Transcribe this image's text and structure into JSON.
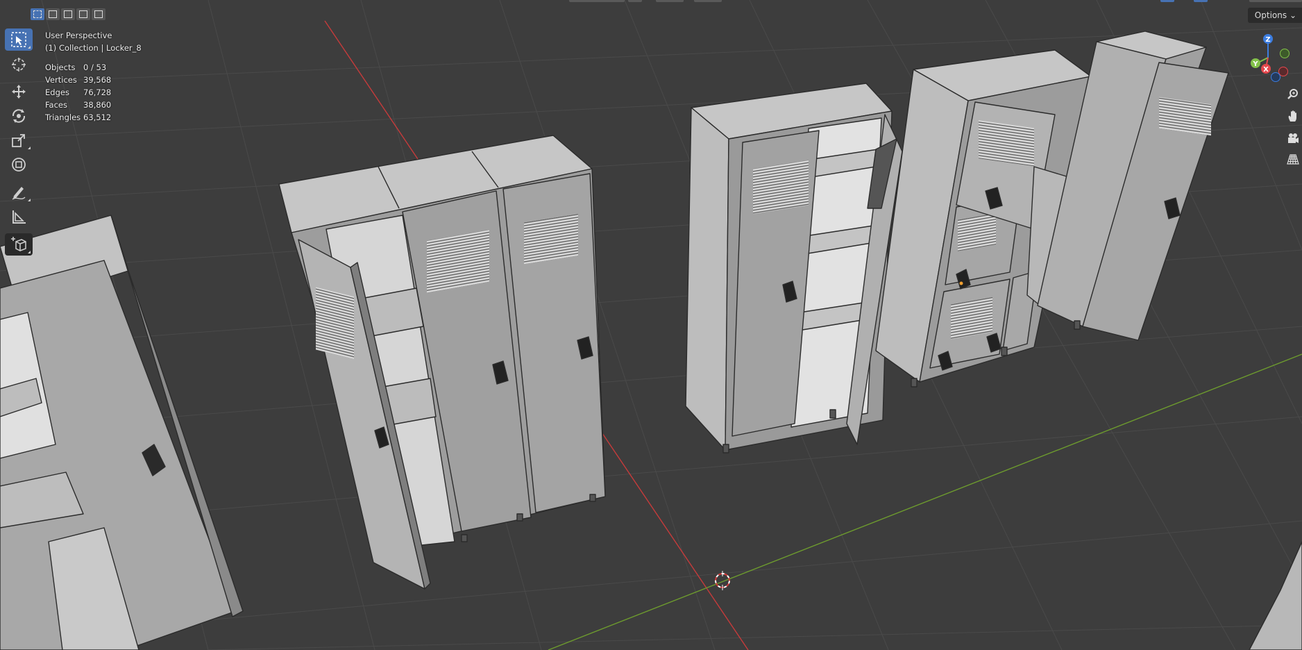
{
  "viewport": {
    "view_name": "User Perspective",
    "collection_line": "(1) Collection | Locker_8"
  },
  "stats": [
    {
      "label": "Objects",
      "value": "0 / 53"
    },
    {
      "label": "Vertices",
      "value": "39,568"
    },
    {
      "label": "Edges",
      "value": "76,728"
    },
    {
      "label": "Faces",
      "value": "38,860"
    },
    {
      "label": "Triangles",
      "value": "63,512"
    }
  ],
  "header": {
    "options_label": "Options",
    "select_modes": [
      "select-new-icon",
      "select-extend-icon",
      "select-subtract-icon",
      "select-invert-icon",
      "select-intersect-icon"
    ]
  },
  "toolbar": {
    "tools": [
      "select-box-icon",
      "cursor-icon",
      "move-icon",
      "rotate-icon",
      "scale-icon",
      "transform-icon",
      "annotate-icon",
      "measure-icon",
      "add-cube-icon"
    ],
    "active_tool": "select-box-icon"
  },
  "gizmo": {
    "x_label": "X",
    "y_label": "Y",
    "z_label": "Z",
    "colors": {
      "x": "#e5484d",
      "y": "#83c14a",
      "z": "#3c7de0"
    }
  },
  "nav_tools": [
    "zoom-icon",
    "hand-pan-icon",
    "camera-icon",
    "perspective-grid-icon"
  ],
  "colors": {
    "background": "#3d3d3d",
    "grid": "#4a4a4a",
    "axis_x": "#c63b3b",
    "axis_y": "#6d9b2e",
    "accent": "#4772b3",
    "locker_light": "#c9c9c9",
    "locker_mid": "#a8a8a8",
    "locker_dark": "#8a8a8a"
  }
}
